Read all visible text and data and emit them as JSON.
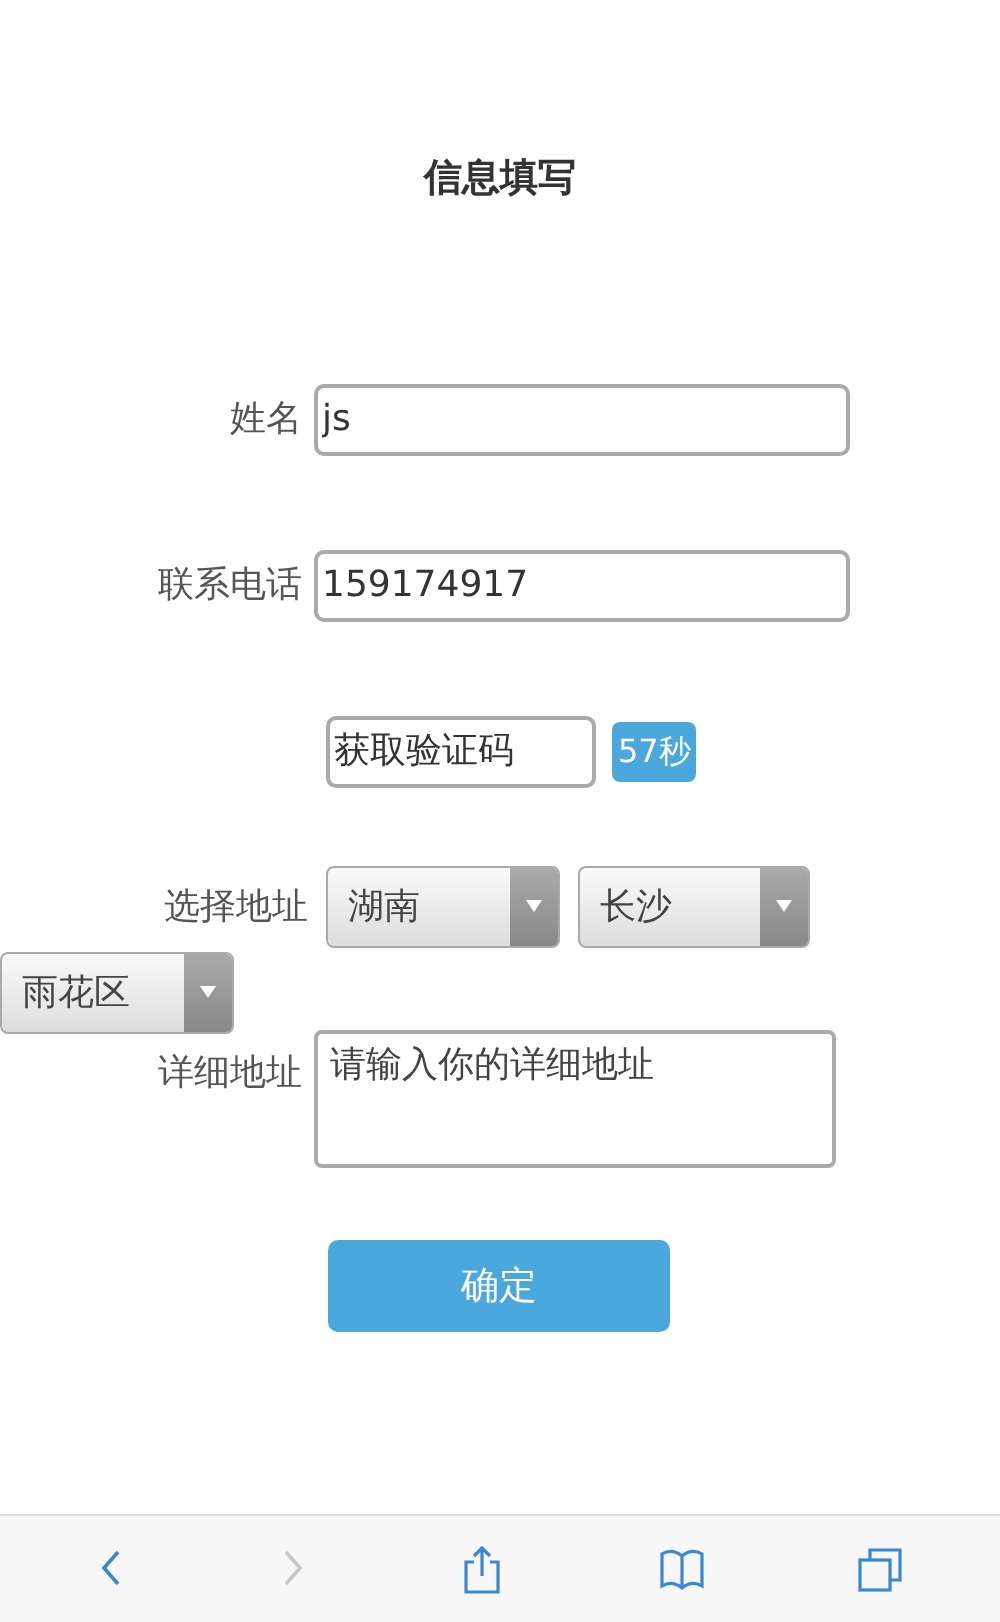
{
  "page": {
    "title": "信息填写"
  },
  "fields": [
    {
      "label": "姓名",
      "value": "js"
    },
    {
      "label": "联系电话",
      "value": "159174917"
    }
  ],
  "verification": {
    "button": "获取验证码",
    "countdown": "57秒"
  },
  "address": {
    "label": "选择地址",
    "selects": [
      {
        "value": "湖南"
      },
      {
        "value": "长沙"
      },
      {
        "value": "雨花区"
      }
    ]
  },
  "detail": {
    "label": "详细地址",
    "placeholder": "请输入你的详细地址"
  },
  "submit": "确定",
  "toolbar": [
    {
      "kind": "back",
      "disabled": false
    },
    {
      "kind": "forward",
      "disabled": true
    },
    {
      "kind": "share",
      "disabled": false
    },
    {
      "kind": "bookmarks",
      "disabled": false
    },
    {
      "kind": "tabs",
      "disabled": false
    }
  ]
}
